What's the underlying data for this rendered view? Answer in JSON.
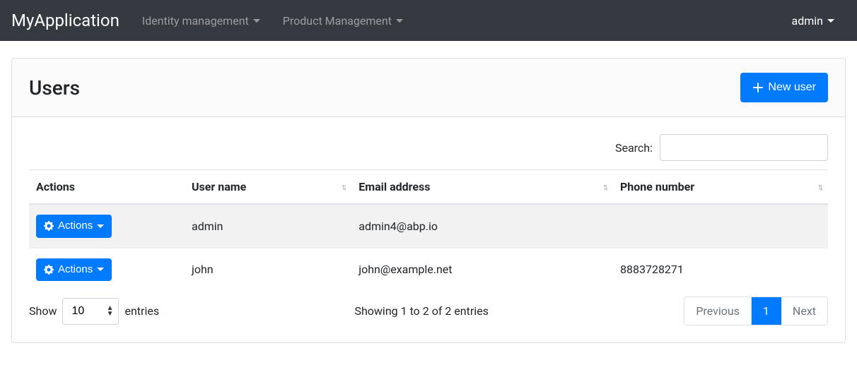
{
  "navbar": {
    "brand": "MyApplication",
    "menus": [
      {
        "label": "Identity management"
      },
      {
        "label": "Product Management"
      }
    ],
    "user": "admin"
  },
  "page": {
    "title": "Users",
    "new_button": "New user"
  },
  "search": {
    "label": "Search:",
    "value": ""
  },
  "table": {
    "columns": {
      "actions": "Actions",
      "username": "User name",
      "email": "Email address",
      "phone": "Phone number"
    },
    "actions_button": "Actions",
    "rows": [
      {
        "username": "admin",
        "email": "admin4@abp.io",
        "phone": ""
      },
      {
        "username": "john",
        "email": "john@example.net",
        "phone": "8883728271"
      }
    ]
  },
  "pager": {
    "show_label": "Show",
    "entries_label": "entries",
    "page_size": "10",
    "info": "Showing 1 to 2 of 2 entries",
    "previous": "Previous",
    "next": "Next",
    "current_page": "1"
  },
  "colors": {
    "primary": "#007bff",
    "navbar": "#343a40"
  }
}
